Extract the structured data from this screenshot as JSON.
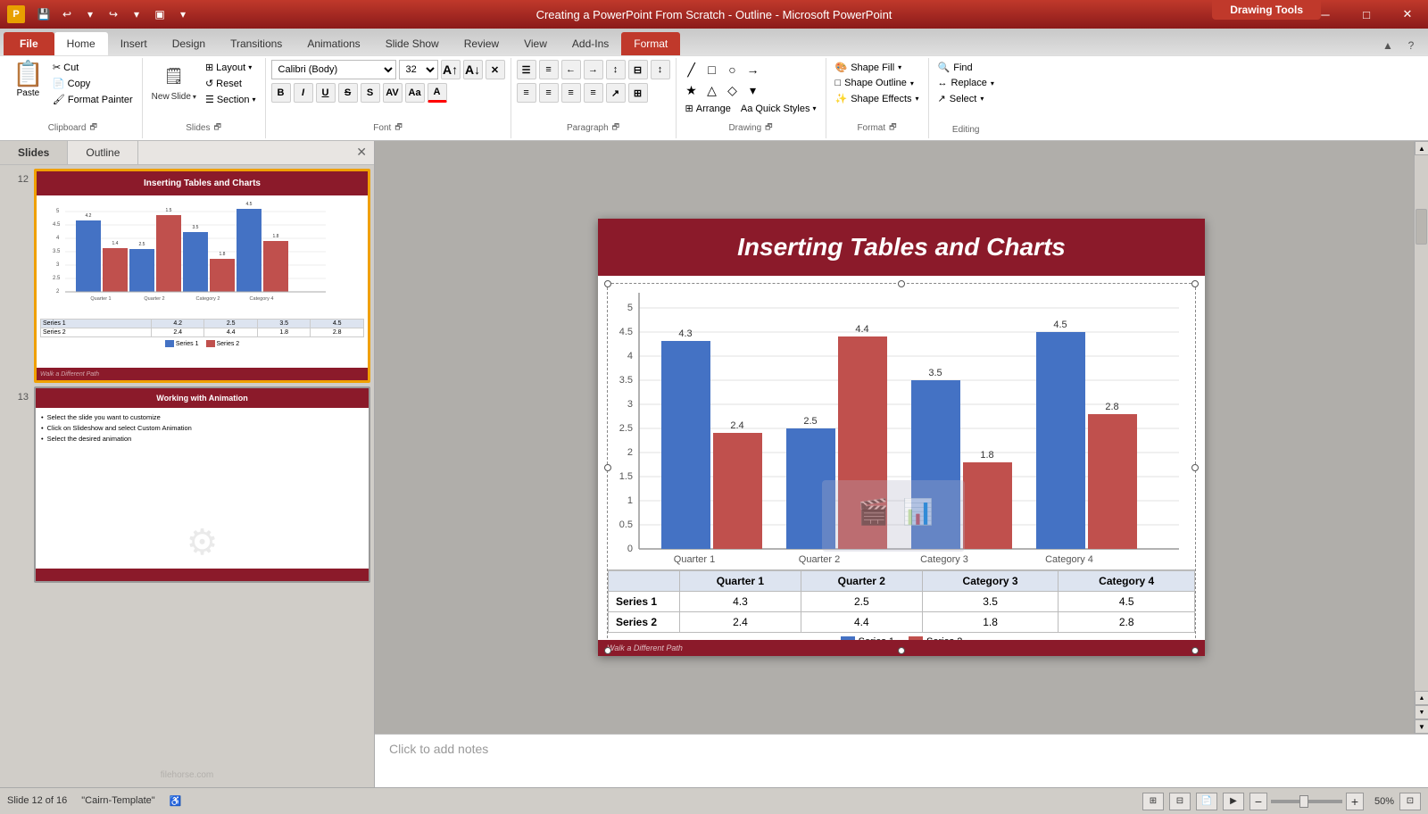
{
  "window": {
    "title": "Creating a PowerPoint From Scratch - Outline - Microsoft PowerPoint",
    "drawing_tools": "Drawing Tools"
  },
  "tabs": {
    "file": "File",
    "home": "Home",
    "insert": "Insert",
    "design": "Design",
    "transitions": "Transitions",
    "animations": "Animations",
    "slideshow": "Slide Show",
    "review": "Review",
    "view": "View",
    "addins": "Add-Ins",
    "format": "Format"
  },
  "ribbon": {
    "clipboard_label": "Clipboard",
    "slides_label": "Slides",
    "font_label": "Font",
    "paragraph_label": "Paragraph",
    "drawing_label": "Drawing",
    "editing_label": "Editing",
    "paste": "Paste",
    "layout": "Layout",
    "reset": "Reset",
    "section": "Section",
    "font_name": "Calibri (Body)",
    "font_size": "32",
    "bold": "B",
    "italic": "I",
    "underline": "U",
    "shapes_label": "Shapes",
    "arrange_label": "Arrange",
    "quick_styles_label": "Quick Styles",
    "shape_fill": "Shape Fill",
    "shape_outline": "Shape Outline",
    "shape_effects": "Shape Effects",
    "find": "Find",
    "replace": "Replace",
    "select": "Select"
  },
  "panel": {
    "slides_tab": "Slides",
    "outline_tab": "Outline"
  },
  "slides": [
    {
      "num": 12,
      "title": "Inserting Tables and Charts",
      "selected": true
    },
    {
      "num": 13,
      "title": "Working with Animation",
      "selected": false
    }
  ],
  "slide13": {
    "title": "Working with Animation",
    "bullets": [
      "Select the slide you want to customize",
      "Click on Slideshow and select Custom Animation",
      "Select the desired animation"
    ]
  },
  "main_slide": {
    "title": "Inserting Tables and Charts",
    "footer": "Walk a Different Path"
  },
  "chart": {
    "y_labels": [
      "5",
      "4.5",
      "4",
      "3.5",
      "3",
      "2.5",
      "2",
      "1.5",
      "1",
      "0.5",
      "0"
    ],
    "categories": [
      "Quarter 1",
      "Quarter 2",
      "Category 3",
      "Category 4"
    ],
    "series1_label": "Series 1",
    "series2_label": "Series 2",
    "data": {
      "series1": [
        4.3,
        2.5,
        3.5,
        4.5
      ],
      "series2": [
        2.4,
        4.4,
        1.8,
        2.8
      ]
    },
    "bar_labels_s1": [
      "4.3",
      "2.5",
      "3.5",
      "4.5"
    ],
    "bar_labels_s2": [
      "2.4",
      "4.4",
      "1.8",
      "2.8"
    ],
    "table": {
      "headers": [
        "",
        "Quarter 1",
        "Quarter 2",
        "Category 3",
        "Category 4"
      ],
      "rows": [
        [
          "Series 1",
          "4.3",
          "2.5",
          "3.5",
          "4.5"
        ],
        [
          "Series 2",
          "2.4",
          "4.4",
          "1.8",
          "2.8"
        ]
      ]
    }
  },
  "notes": {
    "placeholder": "Click to add notes"
  },
  "statusbar": {
    "slide_info": "Slide 12 of 16",
    "theme": "\"Cairn-Template\"",
    "zoom": "50%"
  }
}
